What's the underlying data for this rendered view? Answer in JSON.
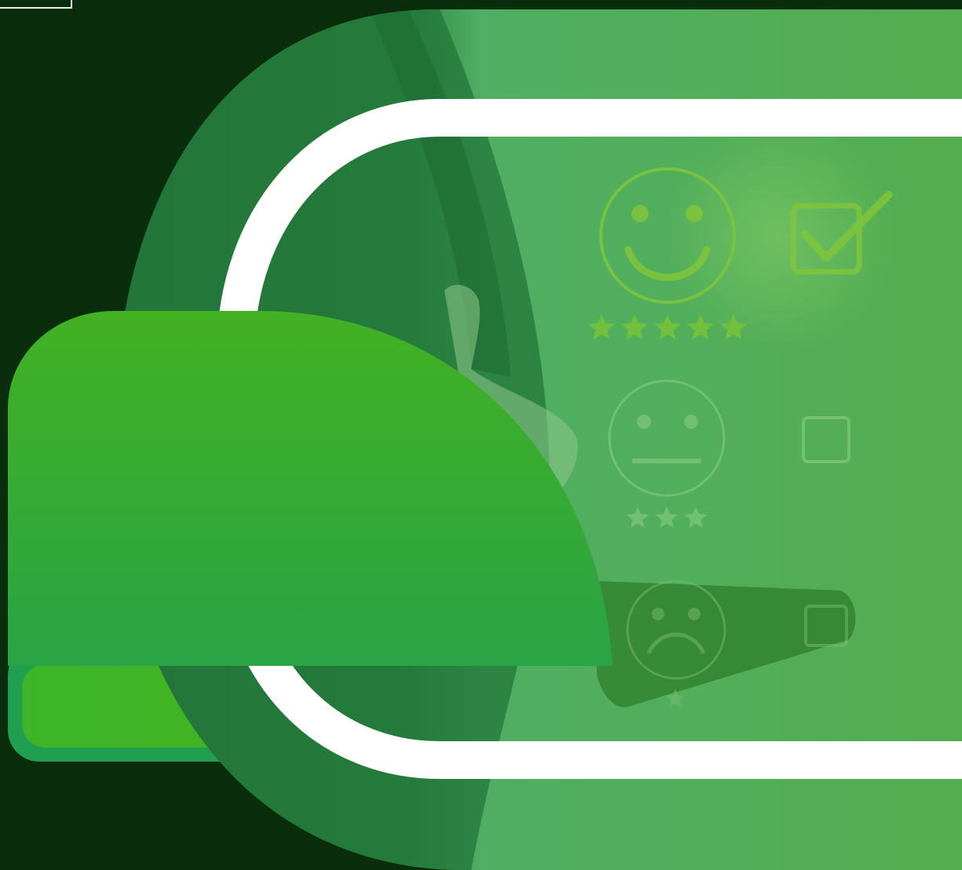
{
  "colors": {
    "background": "#0a2e0c",
    "photo_panel_dark": "#237a3c",
    "photo_panel_light": "#52b061",
    "white_ring": "#ffffff",
    "icon_green": "#7cc83e",
    "icon_faint": "#8fd18a",
    "bright_green_top": "#41b123",
    "bright_green_bottom": "#2aa543",
    "lower_bar_rim": "#21a04d",
    "lower_bar_fill": "#3fb22a"
  },
  "rating_rows": [
    {
      "face": "happy-face",
      "stars": 5,
      "checkbox_checked": true
    },
    {
      "face": "neutral-face",
      "stars": 3,
      "checkbox_checked": false
    },
    {
      "face": "sad-face",
      "stars": 1,
      "checkbox_checked": false
    }
  ],
  "icons": [
    "happy-face-icon",
    "neutral-face-icon",
    "sad-face-icon",
    "star-icon",
    "checkbox-checked-icon",
    "checkbox-empty-icon",
    "thumbs-up-hand"
  ]
}
